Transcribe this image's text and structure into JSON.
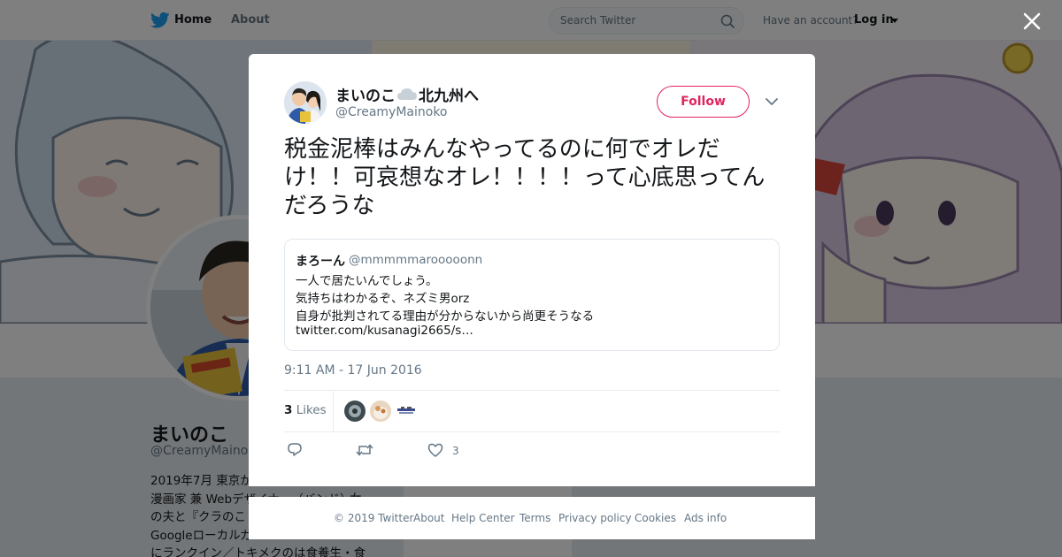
{
  "nav": {
    "home": "Home",
    "about": "About",
    "search_placeholder": "Search Twitter",
    "have_account": "Have an account?",
    "login": "Log in"
  },
  "profile": {
    "name": "まいのこ",
    "handle": "@CreamyMainoko",
    "bio_lines": [
      "2019年7月 東京か",
      "漫画家 兼 Webデザイナー（バンド）·女",
      "の夫と『クラのこ",
      "Googleローカルガ",
      "にランクイン／トキメクのは食養生・食"
    ]
  },
  "tweet": {
    "author_name_before_icon": "まいのこ",
    "author_name_after_icon": "北九州へ",
    "author_name_icon": "cloud-icon",
    "author_handle": "@CreamyMainoko",
    "follow_label": "Follow",
    "text": "税金泥棒はみんなやってるのに何でオレだけ！！可哀想なオレ！！！！って心底思ってんだろうな",
    "quote": {
      "name": "まろーん",
      "handle": "@mmmmmarooooonn",
      "lines": [
        "一人で居たいんでしょう。",
        "気持ちはわかるぞ、ネズミ男orz",
        "自身が批判されてる理由が分からないから尚更そうなる",
        "twitter.com/kusanagi2665/s…"
      ]
    },
    "timestamp": "9:11 AM - 17 Jun 2016",
    "likes_count": "3",
    "likes_label": "Likes",
    "like_action_count": "3"
  },
  "footer": {
    "links": [
      "© 2019 Twitter",
      "About",
      "Help Center",
      "Terms",
      "Privacy policy",
      "Cookies",
      "Ads info"
    ]
  },
  "colors": {
    "accent_pink": "#e0245e",
    "twitter_blue": "#1da1f2",
    "secondary_text": "#657786"
  }
}
